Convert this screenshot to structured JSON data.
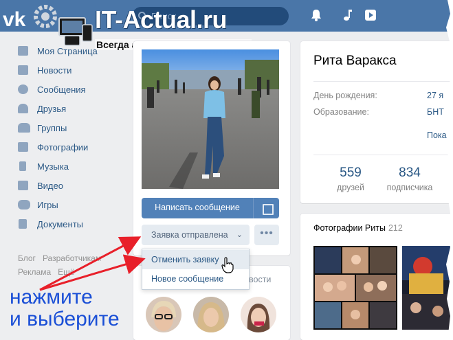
{
  "topbar": {
    "search_placeholder": "Поиск",
    "icons": [
      "bell-icon",
      "music-note-icon",
      "play-icon"
    ]
  },
  "watermark": {
    "title": "IT-Actual.ru",
    "subtitle": "Всегда актуальная информация"
  },
  "menu": {
    "items": [
      {
        "label": "Моя Страница",
        "icon": "home-icon"
      },
      {
        "label": "Новости",
        "icon": "news-icon"
      },
      {
        "label": "Сообщения",
        "icon": "chat-icon"
      },
      {
        "label": "Друзья",
        "icon": "person-icon"
      },
      {
        "label": "Группы",
        "icon": "group-icon"
      },
      {
        "label": "Фотографии",
        "icon": "camera-icon"
      },
      {
        "label": "Музыка",
        "icon": "music-icon"
      },
      {
        "label": "Видео",
        "icon": "film-icon"
      },
      {
        "label": "Игры",
        "icon": "gamepad-icon"
      },
      {
        "label": "Документы",
        "icon": "document-icon"
      }
    ],
    "footer": {
      "blog": "Блог",
      "developers": "Разработчикам",
      "ads": "Реклама",
      "more": "Ещё"
    }
  },
  "profile": {
    "write_button": "Написать сообщение",
    "request_button": "Заявка отправлена",
    "more_button": "•••",
    "dropdown": {
      "cancel_request": "Отменить заявку",
      "new_message": "Новое сообщение"
    },
    "friends_tail": "вости"
  },
  "info": {
    "name": "Рита Варакса",
    "birthday_label": "День рождения:",
    "birthday_value": "27 я",
    "education_label": "Образование:",
    "education_value": "БНТ",
    "show_more": "Пока",
    "friends_count": "559",
    "friends_label": "друзей",
    "followers_count": "834",
    "followers_label": "подписчика"
  },
  "photos": {
    "title": "Фотографии Риты",
    "count": "212"
  },
  "annotation": {
    "line1": "нажмите",
    "line2": "и выберите"
  },
  "colors": {
    "header": "#4a76a8",
    "link": "#2a5885",
    "button_primary": "#5181b8",
    "button_secondary": "#e5ebf1",
    "annotation_arrow": "#e8202a",
    "annotation_text": "#1a4fd6"
  }
}
